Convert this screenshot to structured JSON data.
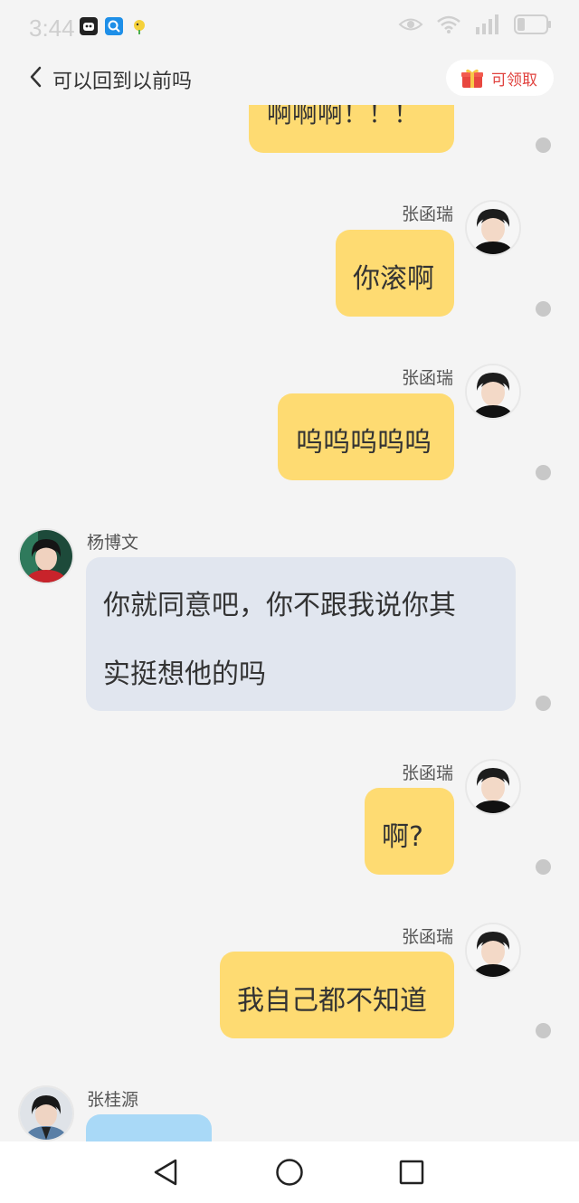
{
  "status": {
    "time": "3:44"
  },
  "header": {
    "title": "可以回到以前吗",
    "claim_label": "可领取"
  },
  "messages": [
    {
      "sender": "",
      "text": "啊啊啊！！！",
      "side": "right"
    },
    {
      "sender": "张函瑞",
      "text": "你滚啊",
      "side": "right"
    },
    {
      "sender": "张函瑞",
      "text": "呜呜呜呜呜",
      "side": "right"
    },
    {
      "sender": "杨博文",
      "text_line1": "你就同意吧，你不跟我说你其",
      "text_line2": "实挺想他的吗",
      "side": "left"
    },
    {
      "sender": "张函瑞",
      "text": "啊?",
      "side": "right"
    },
    {
      "sender": "张函瑞",
      "text": "我自己都不知道",
      "side": "right"
    },
    {
      "sender": "张桂源",
      "text": "",
      "side": "left"
    }
  ],
  "colors": {
    "my_bubble": "#fedb72",
    "other_bubble": "#e1e6ef",
    "claim_text": "#e0423e",
    "background": "#f4f4f4"
  },
  "icons": [
    "back-chevron-icon",
    "gift-box-icon",
    "eye-icon",
    "wifi-icon",
    "signal-icon",
    "battery-icon",
    "nav-back-icon",
    "nav-home-icon",
    "nav-recents-icon"
  ]
}
